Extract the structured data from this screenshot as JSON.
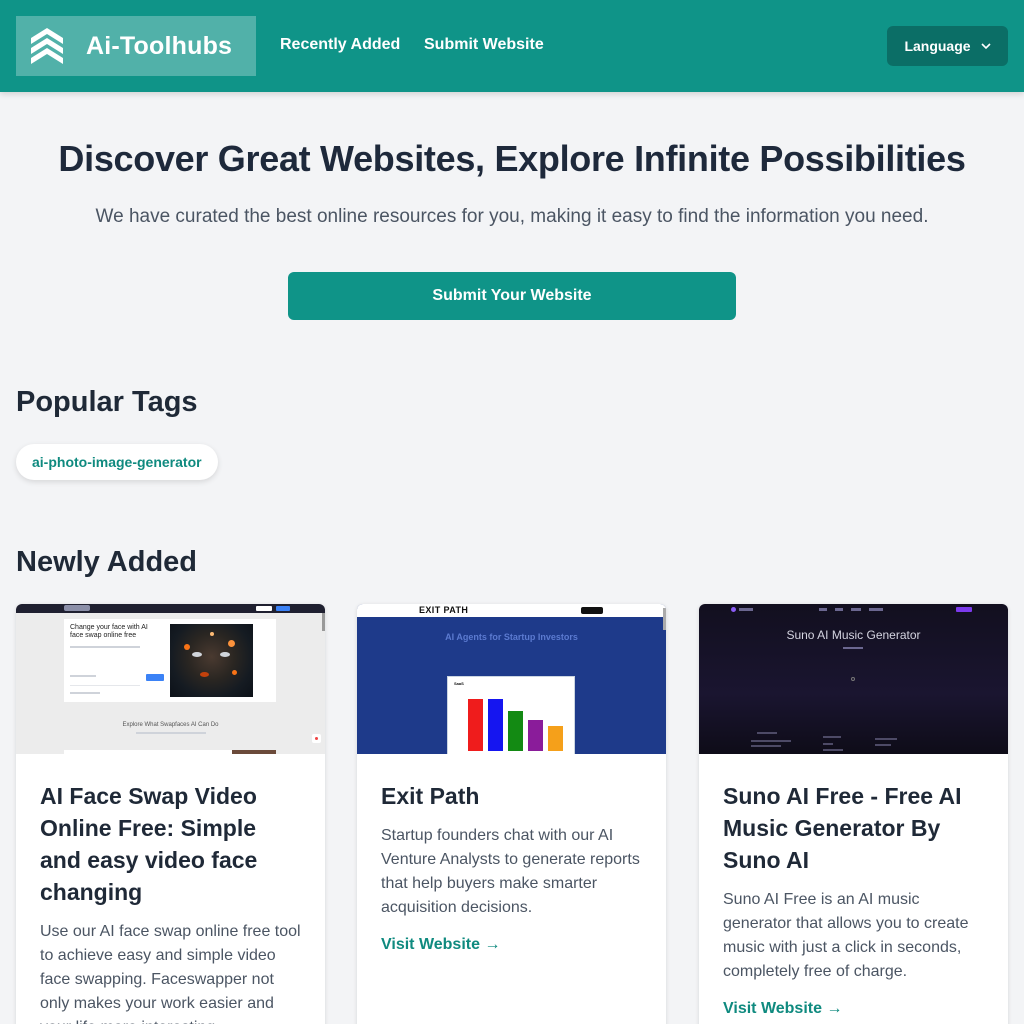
{
  "header": {
    "brand": "Ai-Toolhubs",
    "nav": [
      "Recently Added",
      "Submit Website"
    ],
    "language_label": "Language"
  },
  "hero": {
    "title": "Discover Great Websites, Explore Infinite Possibilities",
    "subtitle": "We have curated the best online resources for you, making it easy to find the information you need.",
    "cta": "Submit Your Website"
  },
  "popular_tags": {
    "title": "Popular Tags",
    "tags": [
      "ai-photo-image-generator"
    ]
  },
  "newly_added": {
    "title": "Newly Added",
    "visit_label": "Visit Website →",
    "cards": [
      {
        "title": "AI Face Swap Video Online Free: Simple and easy video face changing",
        "description": "Use our AI face swap online free tool to achieve easy and simple video face swapping. Faceswapper not only makes your work easier and your life more interesting.",
        "thumb": {
          "headline": "Change your face with AI face swap online free",
          "section": "Explore What Swapfaces AI Can Do"
        }
      },
      {
        "title": "Exit Path",
        "description": "Startup founders chat with our AI Venture Analysts to generate reports that help buyers make smarter acquisition decisions.",
        "thumb": {
          "brand": "EXIT PATH",
          "headline": "AI Agents for Startup Investors",
          "chart_label": "SaaS",
          "bar_colors": [
            "#ef1c1c",
            "#1515f0",
            "#138a13",
            "#8a1c9a",
            "#f5a01a"
          ],
          "bar_values": [
            0.84,
            0.84,
            0.64,
            0.5,
            0.4
          ]
        }
      },
      {
        "title": "Suno AI Free - Free AI Music Generator By Suno AI",
        "description": "Suno AI Free is an AI music generator that allows you to create music with just a click in seconds, completely free of charge.",
        "thumb": {
          "headline": "Suno AI Music Generator"
        }
      }
    ]
  },
  "colors": {
    "primary": "#0f9488",
    "primary_dark": "#0b6e66",
    "link": "#0f8a7f",
    "background": "#f3f4f6"
  }
}
